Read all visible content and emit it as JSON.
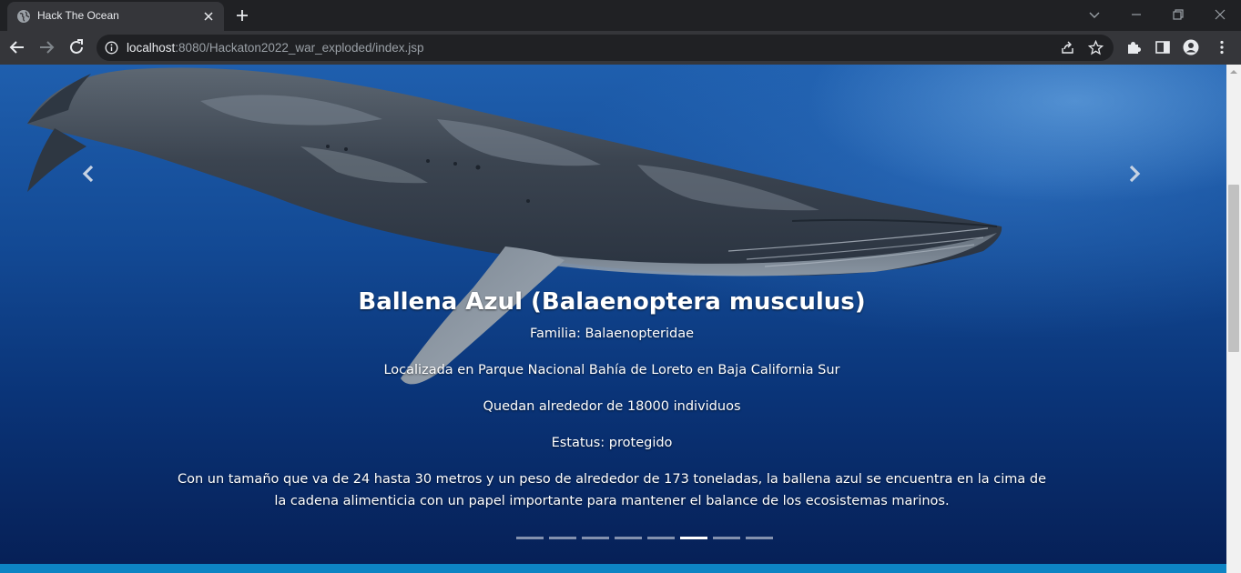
{
  "browser": {
    "tab_title": "Hack The Ocean",
    "url_host": "localhost",
    "url_rest": ":8080/Hackaton2022_war_exploded/index.jsp"
  },
  "slide": {
    "title": "Ballena Azul (Balaenoptera musculus)",
    "familia": "Familia: Balaenopteridae",
    "localizada": "Localizada en Parque Nacional Bahía de Loreto en Baja California Sur",
    "quedan": "Quedan alrededor de 18000 individuos",
    "estatus": "Estatus: protegido",
    "descripcion": "Con un tamaño que va de 24 hasta 30 metros y un peso de alrededor de 173 toneladas, la ballena azul se encuentra en la cima de la cadena alimenticia con un papel importante para mantener el balance de los ecosistemas marinos."
  },
  "carousel": {
    "indicator_count": 8,
    "active_index": 5
  },
  "colors": {
    "ocean_top": "#1f5fae",
    "ocean_bottom": "#061f55",
    "footer_bar": "#0d84c4"
  }
}
